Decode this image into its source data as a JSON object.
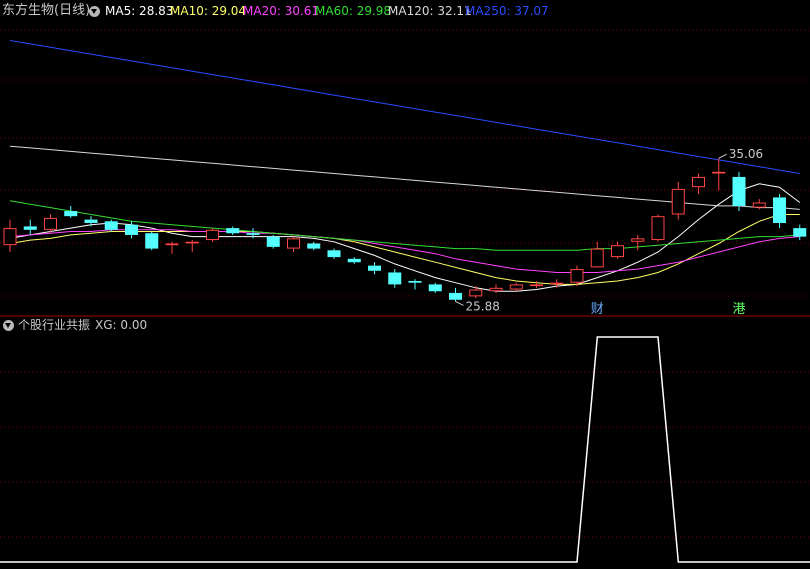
{
  "header": {
    "title": "东方生物(日线)",
    "ma": [
      {
        "label": "MA5: 28.83",
        "color": "#ffffff"
      },
      {
        "label": "MA10: 29.04",
        "color": "#ffff66"
      },
      {
        "label": "MA20: 30.61",
        "color": "#ff44ff"
      },
      {
        "label": "MA60: 29.98",
        "color": "#33dd33"
      },
      {
        "label": "MA120: 32.11",
        "color": "#d8d8d8"
      },
      {
        "label": "MA250: 37.07",
        "color": "#2a4bff"
      }
    ]
  },
  "indicator": {
    "title": "个股行业共振",
    "xg_label": "XG: 0.00"
  },
  "chart_data": [
    {
      "type": "candlestick",
      "title": "东方生物(日线)",
      "up_color": "#ff4444",
      "down_color": "#54ffff",
      "candles": [
        {
          "o": 28.8,
          "h": 30.3,
          "l": 28.4,
          "c": 29.8
        },
        {
          "o": 29.9,
          "h": 30.3,
          "l": 29.4,
          "c": 29.7
        },
        {
          "o": 29.7,
          "h": 30.6,
          "l": 29.5,
          "c": 30.4
        },
        {
          "o": 30.8,
          "h": 31.1,
          "l": 30.4,
          "c": 30.5
        },
        {
          "o": 30.3,
          "h": 30.5,
          "l": 29.9,
          "c": 30.1
        },
        {
          "o": 30.2,
          "h": 30.3,
          "l": 29.6,
          "c": 29.7
        },
        {
          "o": 30.0,
          "h": 30.2,
          "l": 29.2,
          "c": 29.4
        },
        {
          "o": 29.5,
          "h": 29.6,
          "l": 28.5,
          "c": 28.6
        },
        {
          "o": 28.8,
          "h": 29.0,
          "l": 28.3,
          "c": 28.9
        },
        {
          "o": 28.9,
          "h": 29.1,
          "l": 28.4,
          "c": 29.0
        },
        {
          "o": 29.1,
          "h": 29.8,
          "l": 29.0,
          "c": 29.7
        },
        {
          "o": 29.8,
          "h": 29.9,
          "l": 29.4,
          "c": 29.5
        },
        {
          "o": 29.5,
          "h": 29.8,
          "l": 29.2,
          "c": 29.4
        },
        {
          "o": 29.3,
          "h": 29.4,
          "l": 28.6,
          "c": 28.7
        },
        {
          "o": 28.6,
          "h": 29.3,
          "l": 28.4,
          "c": 29.2
        },
        {
          "o": 28.9,
          "h": 29.0,
          "l": 28.5,
          "c": 28.6
        },
        {
          "o": 28.5,
          "h": 28.6,
          "l": 28.0,
          "c": 28.1
        },
        {
          "o": 28.0,
          "h": 28.1,
          "l": 27.7,
          "c": 27.8
        },
        {
          "o": 27.6,
          "h": 27.8,
          "l": 27.1,
          "c": 27.3
        },
        {
          "o": 27.2,
          "h": 27.4,
          "l": 26.3,
          "c": 26.5
        },
        {
          "o": 26.7,
          "h": 26.8,
          "l": 26.2,
          "c": 26.6
        },
        {
          "o": 26.5,
          "h": 26.6,
          "l": 26.0,
          "c": 26.1
        },
        {
          "o": 26.0,
          "h": 26.3,
          "l": 25.5,
          "c": 25.6
        },
        {
          "o": 25.8,
          "h": 26.4,
          "l": 25.7,
          "c": 26.2
        },
        {
          "o": 26.1,
          "h": 26.5,
          "l": 26.0,
          "c": 26.3
        },
        {
          "o": 26.2,
          "h": 26.6,
          "l": 26.1,
          "c": 26.5
        },
        {
          "o": 26.4,
          "h": 26.7,
          "l": 26.3,
          "c": 26.5
        },
        {
          "o": 26.5,
          "h": 26.8,
          "l": 26.3,
          "c": 26.6
        },
        {
          "o": 26.6,
          "h": 27.6,
          "l": 26.4,
          "c": 27.4
        },
        {
          "o": 27.5,
          "h": 29.0,
          "l": 27.5,
          "c": 28.6
        },
        {
          "o": 28.1,
          "h": 29.0,
          "l": 28.0,
          "c": 28.8
        },
        {
          "o": 29.0,
          "h": 29.4,
          "l": 28.5,
          "c": 29.2
        },
        {
          "o": 29.1,
          "h": 30.6,
          "l": 29.0,
          "c": 30.5
        },
        {
          "o": 30.6,
          "h": 32.5,
          "l": 30.3,
          "c": 32.1
        },
        {
          "o": 32.2,
          "h": 33.0,
          "l": 31.8,
          "c": 32.8
        },
        {
          "o": 33.0,
          "h": 33.9,
          "l": 32.0,
          "c": 33.1
        },
        {
          "o": 32.8,
          "h": 33.1,
          "l": 30.8,
          "c": 31.1
        },
        {
          "o": 31.0,
          "h": 31.5,
          "l": 30.9,
          "c": 31.3
        },
        {
          "o": 31.6,
          "h": 31.8,
          "l": 29.8,
          "c": 30.1
        },
        {
          "o": 29.8,
          "h": 30.0,
          "l": 29.1,
          "c": 29.3
        }
      ],
      "ma_lines": [
        {
          "name": "MA5",
          "color": "#ffffff",
          "values": [
            29.2,
            29.4,
            29.6,
            29.8,
            30.0,
            30.1,
            30.0,
            29.8,
            29.5,
            29.3,
            29.3,
            29.3,
            29.3,
            29.3,
            29.3,
            29.2,
            29.0,
            28.6,
            28.2,
            27.7,
            27.3,
            26.9,
            26.6,
            26.3,
            26.1,
            26.1,
            26.2,
            26.4,
            26.5,
            26.9,
            27.3,
            27.8,
            28.4,
            29.3,
            30.3,
            31.2,
            32.0,
            32.4,
            32.2,
            31.3
          ]
        },
        {
          "name": "MA10",
          "color": "#ffff66",
          "values": [
            28.9,
            29.1,
            29.2,
            29.4,
            29.5,
            29.6,
            29.6,
            29.6,
            29.6,
            29.6,
            29.6,
            29.6,
            29.6,
            29.5,
            29.4,
            29.3,
            29.2,
            29.0,
            28.7,
            28.4,
            28.1,
            27.8,
            27.5,
            27.2,
            26.9,
            26.7,
            26.6,
            26.5,
            26.5,
            26.6,
            26.7,
            26.9,
            27.2,
            27.7,
            28.3,
            28.9,
            29.6,
            30.2,
            30.6,
            30.6
          ]
        },
        {
          "name": "MA20",
          "color": "#ff44ff",
          "values": [
            29.3,
            29.4,
            29.5,
            29.6,
            29.6,
            29.7,
            29.7,
            29.7,
            29.7,
            29.6,
            29.6,
            29.6,
            29.5,
            29.5,
            29.4,
            29.3,
            29.2,
            29.1,
            28.9,
            28.7,
            28.5,
            28.3,
            28.0,
            27.8,
            27.6,
            27.4,
            27.3,
            27.2,
            27.2,
            27.2,
            27.3,
            27.4,
            27.6,
            27.8,
            28.1,
            28.4,
            28.7,
            29.0,
            29.2,
            29.3
          ]
        },
        {
          "name": "MA60",
          "color": "#33dd33",
          "values": [
            31.4,
            31.2,
            31.0,
            30.8,
            30.6,
            30.4,
            30.2,
            30.1,
            30.0,
            29.9,
            29.8,
            29.7,
            29.6,
            29.5,
            29.4,
            29.3,
            29.2,
            29.1,
            29.0,
            28.9,
            28.8,
            28.7,
            28.6,
            28.6,
            28.5,
            28.5,
            28.5,
            28.5,
            28.5,
            28.6,
            28.6,
            28.7,
            28.8,
            28.9,
            29.0,
            29.1,
            29.2,
            29.3,
            29.3,
            29.4
          ]
        },
        {
          "name": "MA120",
          "color": "#d8d8d8",
          "values": [
            34.6,
            34.5,
            34.4,
            34.3,
            34.2,
            34.1,
            34.0,
            33.9,
            33.8,
            33.7,
            33.6,
            33.5,
            33.4,
            33.3,
            33.2,
            33.1,
            33.0,
            32.9,
            32.8,
            32.7,
            32.6,
            32.5,
            32.4,
            32.3,
            32.2,
            32.1,
            32.0,
            31.9,
            31.8,
            31.7,
            31.6,
            31.5,
            31.4,
            31.3,
            31.2,
            31.1,
            31.1,
            31.0,
            31.0,
            30.9
          ]
        },
        {
          "name": "MA250",
          "color": "#2a4bff",
          "values": [
            40.8,
            40.6,
            40.4,
            40.2,
            40.0,
            39.8,
            39.6,
            39.4,
            39.2,
            39.0,
            38.8,
            38.6,
            38.4,
            38.2,
            38.0,
            37.8,
            37.6,
            37.4,
            37.2,
            37.0,
            36.8,
            36.6,
            36.4,
            36.2,
            36.0,
            35.8,
            35.6,
            35.4,
            35.2,
            35.0,
            34.8,
            34.6,
            34.4,
            34.2,
            34.0,
            33.8,
            33.6,
            33.4,
            33.2,
            33.0
          ]
        }
      ],
      "high_label": "35.06",
      "low_label": "25.88",
      "markers": [
        {
          "text": "财",
          "index": 29,
          "color": "#6aaaff"
        },
        {
          "text": "港",
          "index": 36,
          "color": "#66ff66"
        }
      ],
      "ylim": [
        25.0,
        42.0
      ],
      "grid": true
    },
    {
      "type": "line",
      "title": "个股行业共振",
      "series": [
        {
          "name": "XG",
          "color": "#ffffff",
          "values": [
            0,
            0,
            0,
            0,
            0,
            0,
            0,
            0,
            0,
            0,
            0,
            0,
            0,
            0,
            0,
            0,
            0,
            0,
            0,
            0,
            0,
            0,
            0,
            0,
            0,
            0,
            0,
            0,
            0,
            1,
            1,
            1,
            1,
            0,
            0,
            0,
            0,
            0,
            0,
            0
          ]
        }
      ],
      "ylim": [
        0,
        1
      ],
      "grid": true
    }
  ]
}
